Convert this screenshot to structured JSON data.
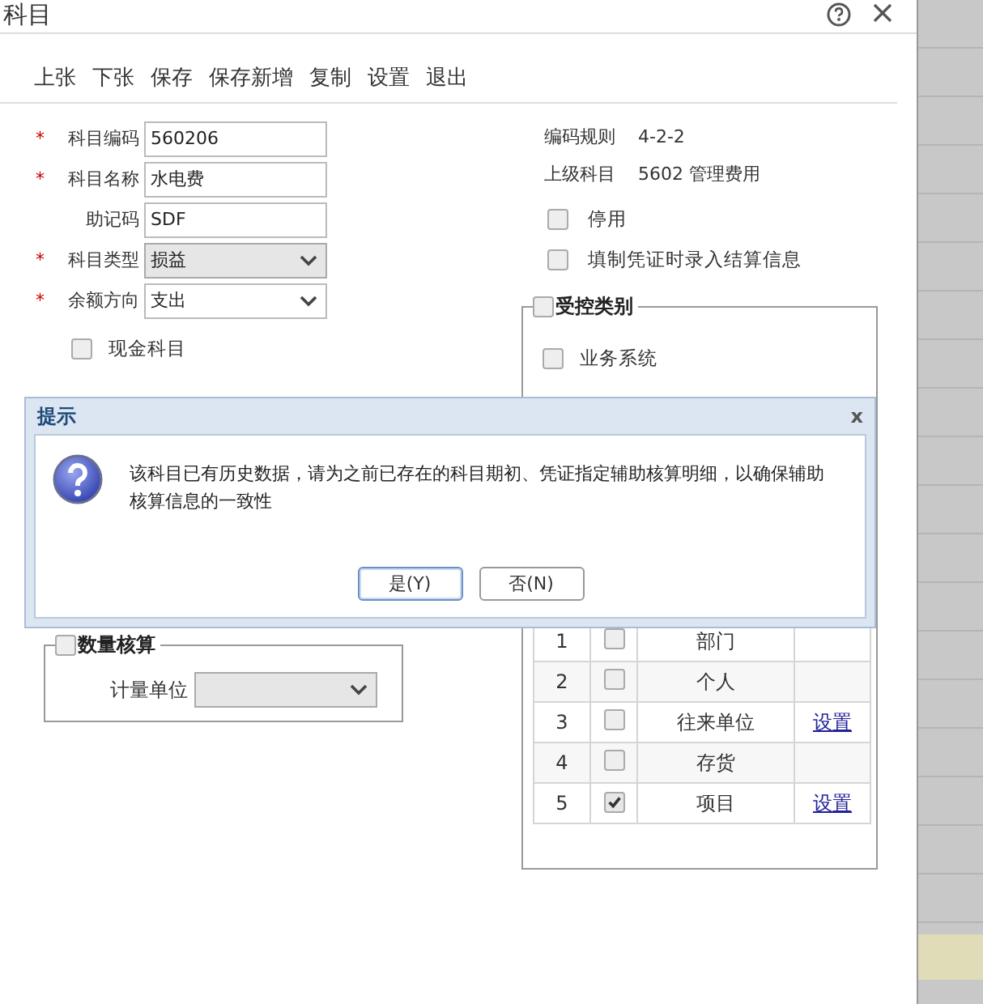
{
  "window": {
    "title": "科目"
  },
  "toolbar": [
    "上张",
    "下张",
    "保存",
    "保存新增",
    "复制",
    "设置",
    "退出"
  ],
  "fields": [
    {
      "required_mark": "*",
      "label": "科目编码",
      "kind": "input",
      "value": "560206"
    },
    {
      "required_mark": "*",
      "label": "科目名称",
      "kind": "input",
      "value": "水电费"
    },
    {
      "label": "助记码",
      "kind": "input",
      "value": "SDF"
    },
    {
      "required_mark": "*",
      "label": "科目类型",
      "kind": "select",
      "value": "损益",
      "disabled": true
    },
    {
      "required_mark": "*",
      "label": "余额方向",
      "kind": "select",
      "value": "支出",
      "disabled": false
    }
  ],
  "info": [
    {
      "label": "编码规则",
      "value": "4-2-2"
    },
    {
      "label": "上级科目",
      "value": "5602 管理费用"
    }
  ],
  "options": [
    {
      "label": "停用",
      "checked": false
    },
    {
      "label": "填制凭证时录入结算信息",
      "checked": false
    }
  ],
  "cash_account": {
    "label": "现金科目",
    "checked": false
  },
  "quantity": {
    "legend": "数量核算",
    "checked": false,
    "unit_label": "计量单位",
    "unit_disabled": true
  },
  "controlled": {
    "legend": "受控类别",
    "checked": false,
    "business_system": {
      "label": "业务系统",
      "checked": false
    }
  },
  "aux_rows": [
    {
      "no": "1",
      "checked": false,
      "name": "部门"
    },
    {
      "no": "2",
      "checked": false,
      "name": "个人"
    },
    {
      "no": "3",
      "checked": false,
      "name": "往来单位",
      "link": "设置"
    },
    {
      "no": "4",
      "checked": false,
      "name": "存货"
    },
    {
      "no": "5",
      "checked": true,
      "name": "项目",
      "link": "设置"
    }
  ],
  "dialog": {
    "title": "提示",
    "close": "x",
    "message": "该科目已有历史数据，请为之前已存在的科目期初、凭证指定辅助核算明细，以确保辅助核算信息的一致性",
    "buttons": [
      {
        "label": "是(Y)",
        "default": true
      },
      {
        "label": "否(N)",
        "default": false
      }
    ]
  }
}
